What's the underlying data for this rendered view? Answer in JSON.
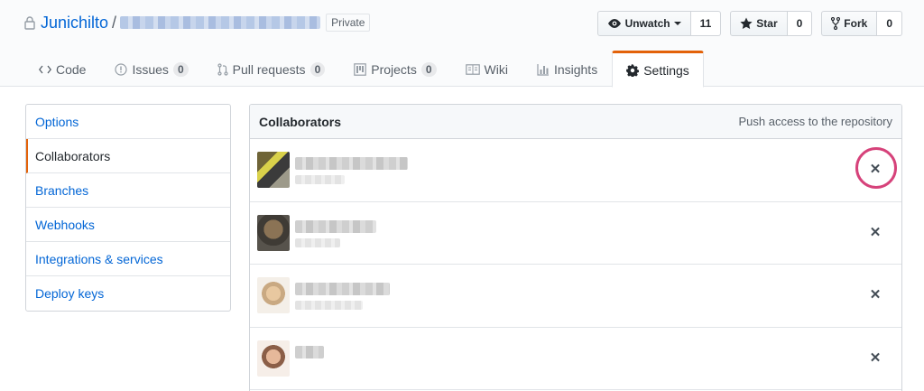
{
  "repo": {
    "owner": "Junichilto",
    "separator": "/",
    "visibility": "Private"
  },
  "actions": [
    {
      "label": "Unwatch",
      "count": "11",
      "icon": "eye-icon"
    },
    {
      "label": "Star",
      "count": "0",
      "icon": "star-icon"
    },
    {
      "label": "Fork",
      "count": "0",
      "icon": "fork-icon"
    }
  ],
  "nav": [
    {
      "label": "Code",
      "counter": null,
      "icon": "code-icon"
    },
    {
      "label": "Issues",
      "counter": "0",
      "icon": "issue-icon"
    },
    {
      "label": "Pull requests",
      "counter": "0",
      "icon": "pull-request-icon"
    },
    {
      "label": "Projects",
      "counter": "0",
      "icon": "project-icon"
    },
    {
      "label": "Wiki",
      "counter": null,
      "icon": "book-icon"
    },
    {
      "label": "Insights",
      "counter": null,
      "icon": "graph-icon"
    },
    {
      "label": "Settings",
      "counter": null,
      "icon": "gear-icon",
      "selected": true
    }
  ],
  "sidebar": {
    "items": [
      {
        "label": "Options"
      },
      {
        "label": "Collaborators",
        "selected": true
      },
      {
        "label": "Branches"
      },
      {
        "label": "Webhooks"
      },
      {
        "label": "Integrations & services"
      },
      {
        "label": "Deploy keys"
      }
    ]
  },
  "collaborators": {
    "title": "Collaborators",
    "note": "Push access to the repository",
    "remove_glyph": "✕",
    "rows": 4
  },
  "colors": {
    "accent": "#e36209",
    "link": "#0366d6",
    "highlight_ring": "#d6427a"
  }
}
